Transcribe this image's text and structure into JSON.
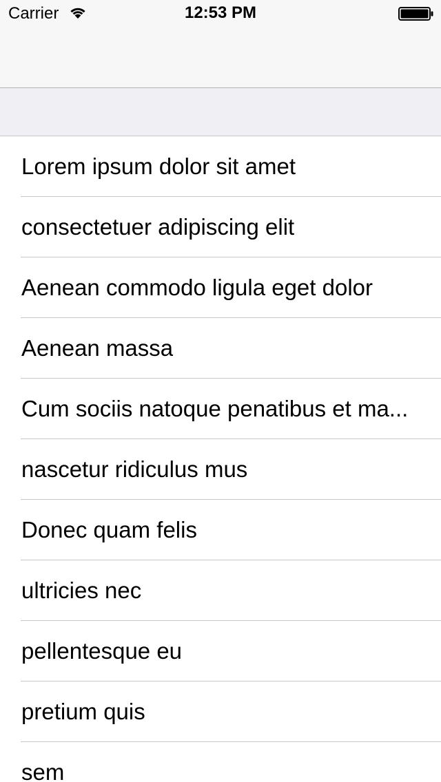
{
  "status_bar": {
    "carrier": "Carrier",
    "time": "12:53 PM",
    "wifi_icon": "wifi-icon",
    "battery_icon": "battery-icon",
    "battery_level": 1.0
  },
  "colors": {
    "nav_background": "#f7f7f7",
    "section_background": "#efeff4",
    "separator": "#c8c7cc",
    "text": "#000000"
  },
  "list": {
    "items": [
      {
        "label": "Lorem ipsum dolor sit amet"
      },
      {
        "label": "consectetuer adipiscing elit"
      },
      {
        "label": "Aenean commodo ligula eget dolor"
      },
      {
        "label": "Aenean massa"
      },
      {
        "label": "Cum sociis natoque penatibus et ma..."
      },
      {
        "label": "nascetur ridiculus mus"
      },
      {
        "label": "Donec quam felis"
      },
      {
        "label": "ultricies nec"
      },
      {
        "label": "pellentesque eu"
      },
      {
        "label": "pretium quis"
      },
      {
        "label": "sem"
      }
    ]
  }
}
